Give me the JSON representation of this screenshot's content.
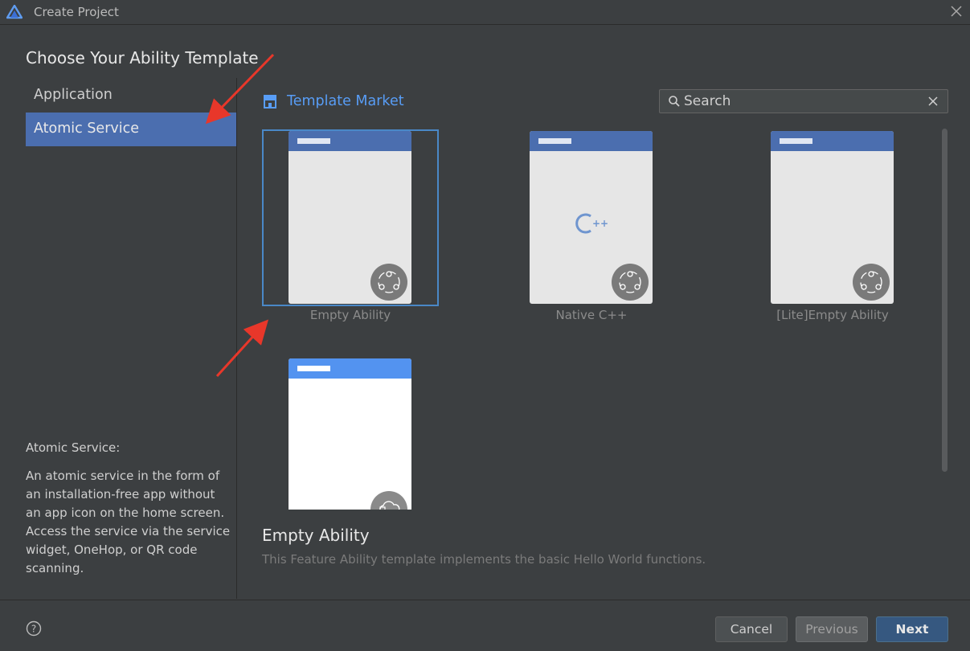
{
  "window": {
    "title": "Create Project"
  },
  "heading": "Choose Your Ability Template",
  "sidebar": {
    "items": [
      {
        "label": "Application",
        "selected": false
      },
      {
        "label": "Atomic Service",
        "selected": true
      }
    ],
    "description_title": "Atomic Service:",
    "description": "An atomic service in the form of an installation-free app without an app icon on the home screen. Access the service via the service widget, OneHop, or QR code scanning."
  },
  "market": {
    "label": "Template Market"
  },
  "search": {
    "value": "",
    "placeholder": "Search"
  },
  "templates": [
    {
      "label": "Empty Ability",
      "selected": true,
      "icon": "atomic-service-icon"
    },
    {
      "label": "Native C++",
      "selected": false,
      "icon": "cpp-icon"
    },
    {
      "label": "[Lite]Empty Ability",
      "selected": false,
      "icon": "atomic-service-icon"
    },
    {
      "label": "",
      "selected": false,
      "icon": "cloud-service-icon"
    }
  ],
  "detail": {
    "title": "Empty Ability",
    "description": "This Feature Ability template implements the basic Hello World functions."
  },
  "footer": {
    "cancel_label": "Cancel",
    "previous_label": "Previous",
    "next_label": "Next"
  },
  "colors": {
    "accent": "#4b6eaf",
    "link": "#589df6",
    "background": "#3c3f41",
    "annotation_arrow": "#e8372a"
  }
}
